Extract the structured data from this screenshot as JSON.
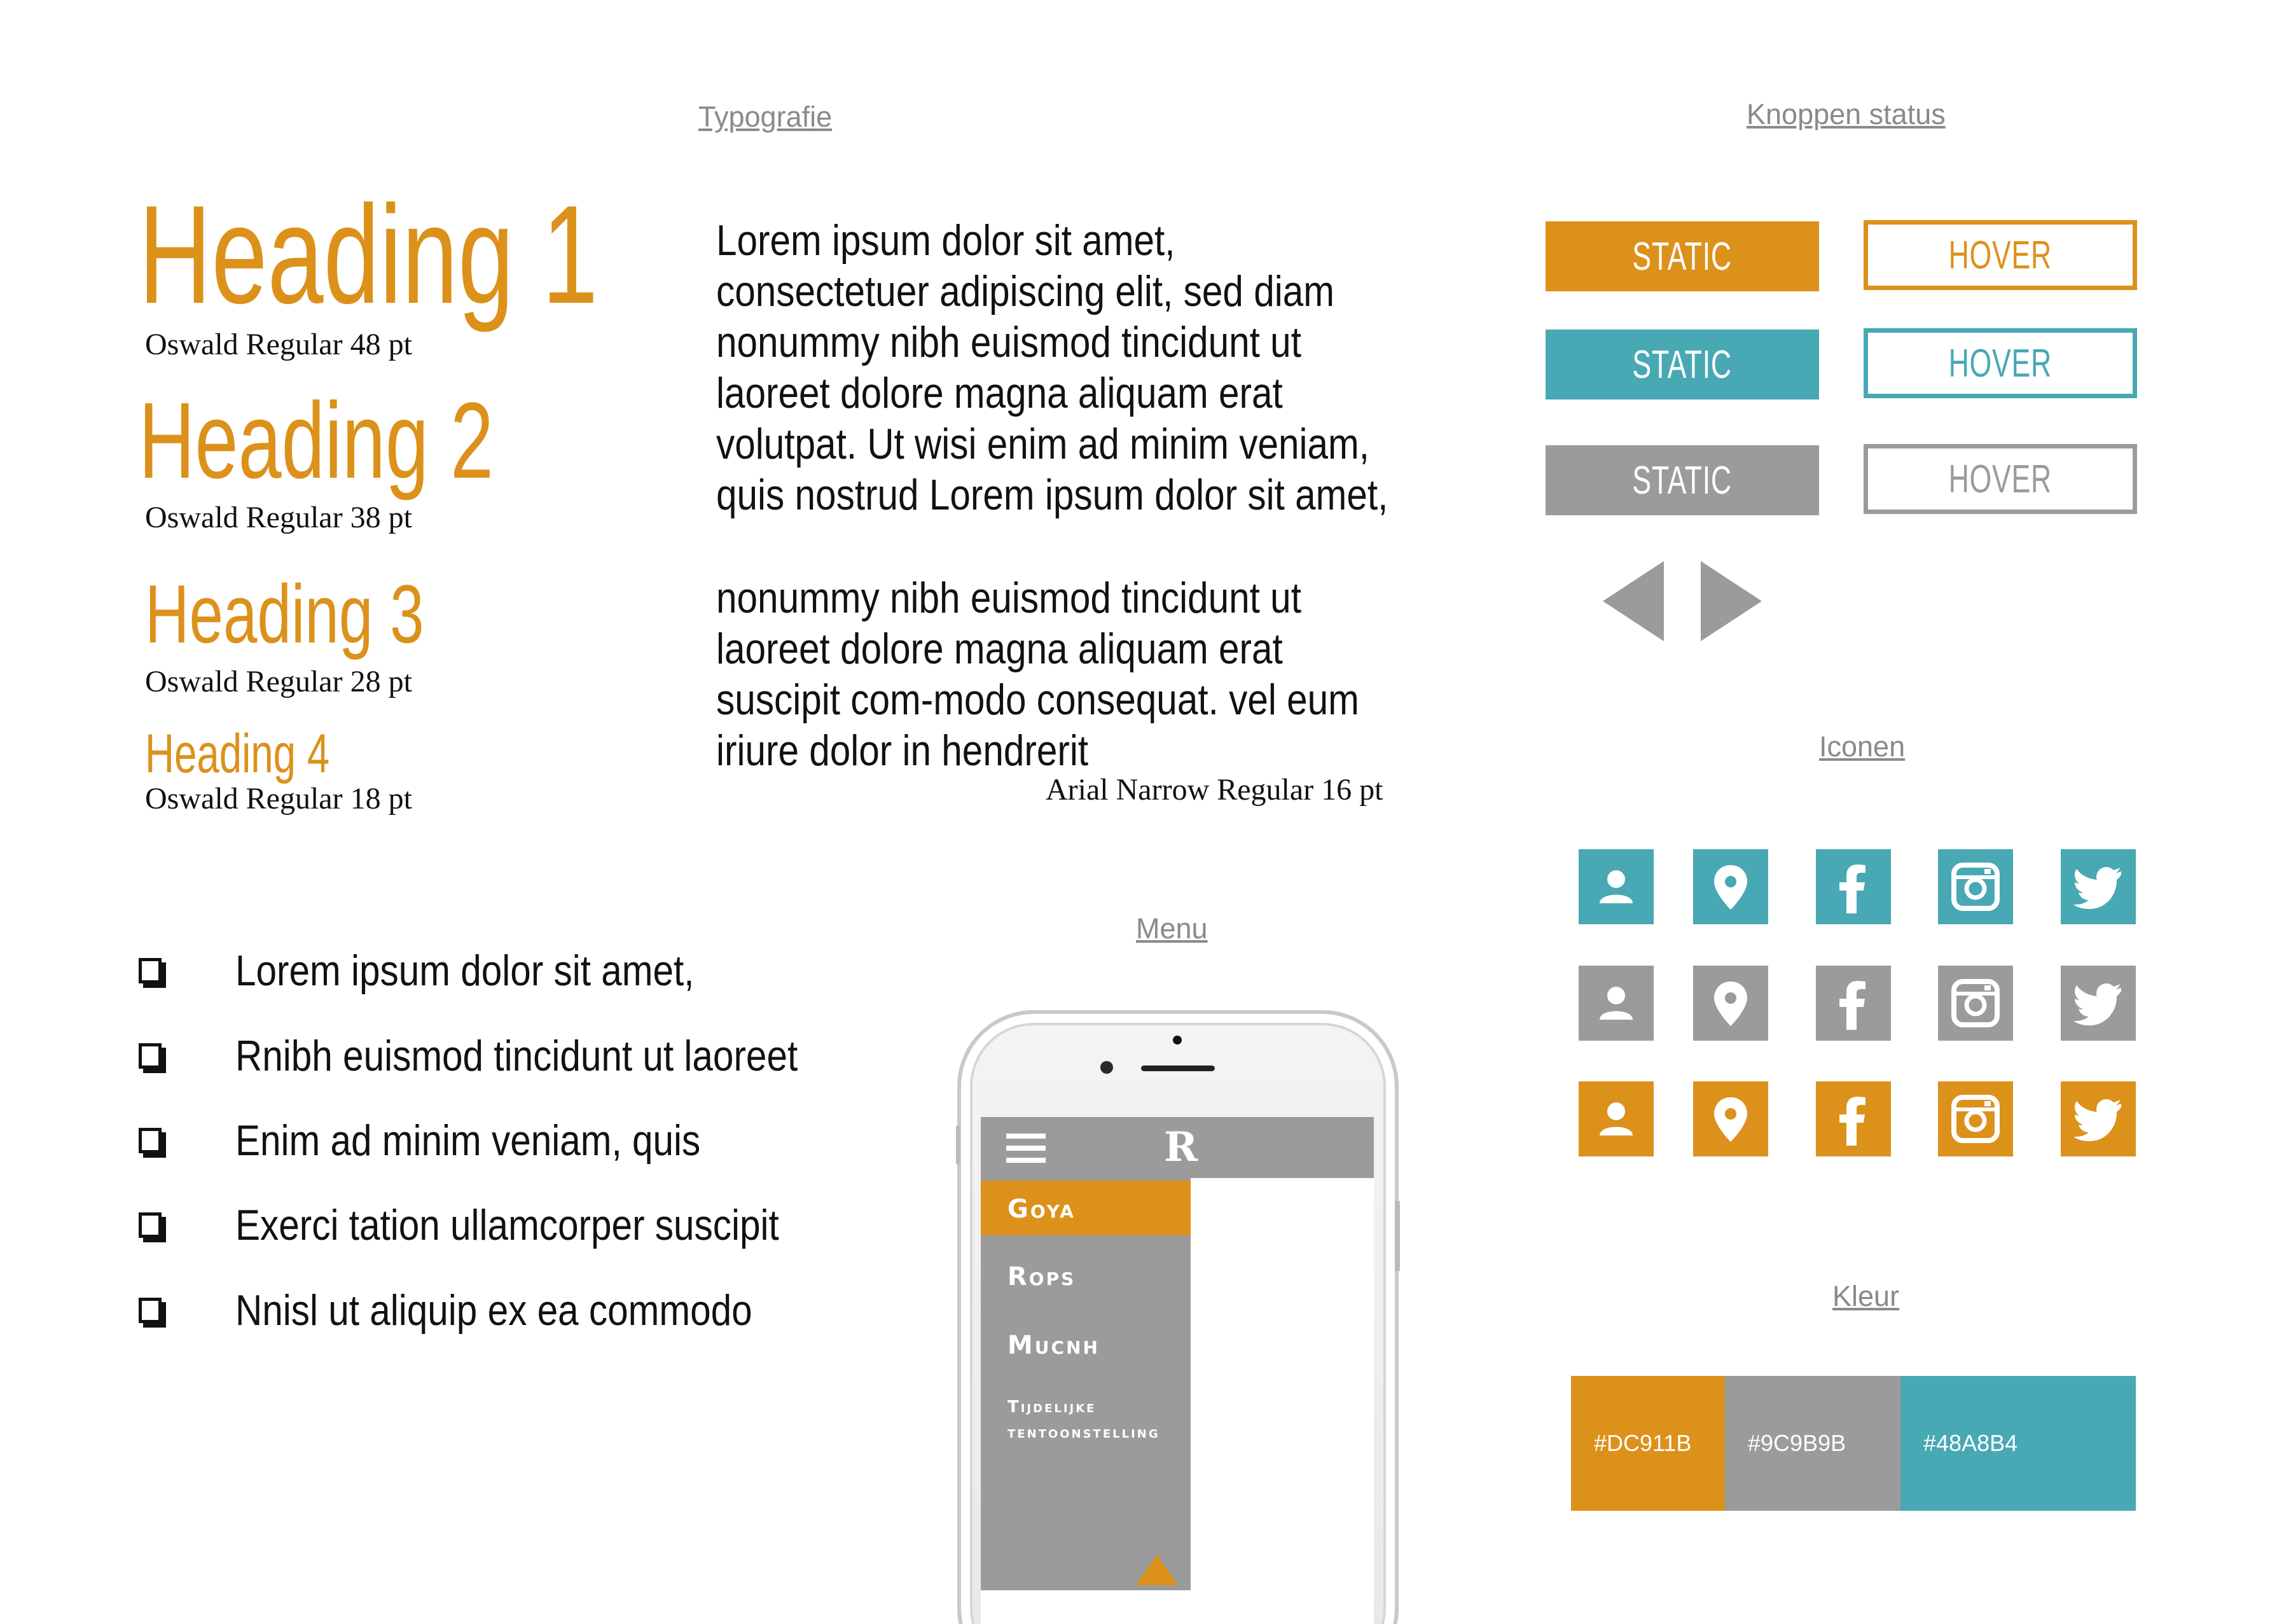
{
  "sections": {
    "typography": "Typografie",
    "buttons": "Knoppen status",
    "icons": "Iconen",
    "menu": "Menu",
    "color": "Kleur"
  },
  "headings": [
    {
      "text": "Heading 1",
      "caption": "Oswald Regular 48 pt"
    },
    {
      "text": "Heading 2",
      "caption": "Oswald Regular 38 pt"
    },
    {
      "text": "Heading 3",
      "caption": "Oswald Regular 28 pt"
    },
    {
      "text": "Heading 4",
      "caption": "Oswald Regular 18 pt"
    }
  ],
  "body_text": {
    "paragraph1": "Lorem ipsum dolor sit amet, consectetuer adipiscing elit, sed diam nonummy nibh euismod tincidunt ut laoreet dolore magna aliquam erat volutpat. Ut wisi enim ad minim veniam, quis nostrud Lorem ipsum dolor sit amet,",
    "paragraph2": "nonummy nibh euismod tincidunt ut laoreet dolore magna aliquam erat  suscipit com-modo consequat. vel eum iriure dolor in hendrerit",
    "caption": "Arial Narrow Regular 16 pt"
  },
  "checklist": [
    "Lorem ipsum dolor sit amet,",
    "Rnibh euismod tincidunt ut laoreet",
    "Enim ad minim veniam, quis",
    "Exerci tation ullamcorper suscipit",
    "Nnisl ut aliquip ex ea commodo"
  ],
  "buttons": {
    "static_label": "STATIC",
    "hover_label": "HOVER",
    "rows": [
      {
        "color": "#DC911B"
      },
      {
        "color": "#48A8B4"
      },
      {
        "color": "#9C9B9B"
      }
    ],
    "arrows": [
      "arrow-left-icon",
      "arrow-right-icon"
    ]
  },
  "icons": {
    "names": [
      "user-icon",
      "location-pin-icon",
      "facebook-icon",
      "instagram-icon",
      "twitter-icon"
    ],
    "row_colors": [
      "#48A8B4",
      "#9C9B9B",
      "#DC911B"
    ]
  },
  "menu": {
    "logo": "R",
    "items": [
      "Goya",
      "Rops",
      "Mucnh",
      "Tijdelijke tentoonstelling"
    ],
    "active_color": "#DC911B",
    "bar_color": "#9C9B9B"
  },
  "colors": [
    {
      "hex": "#DC911B",
      "label": "#DC911B"
    },
    {
      "hex": "#9C9B9B",
      "label": "#9C9B9B"
    },
    {
      "hex": "#48A8B4",
      "label": "#48A8B4"
    }
  ]
}
